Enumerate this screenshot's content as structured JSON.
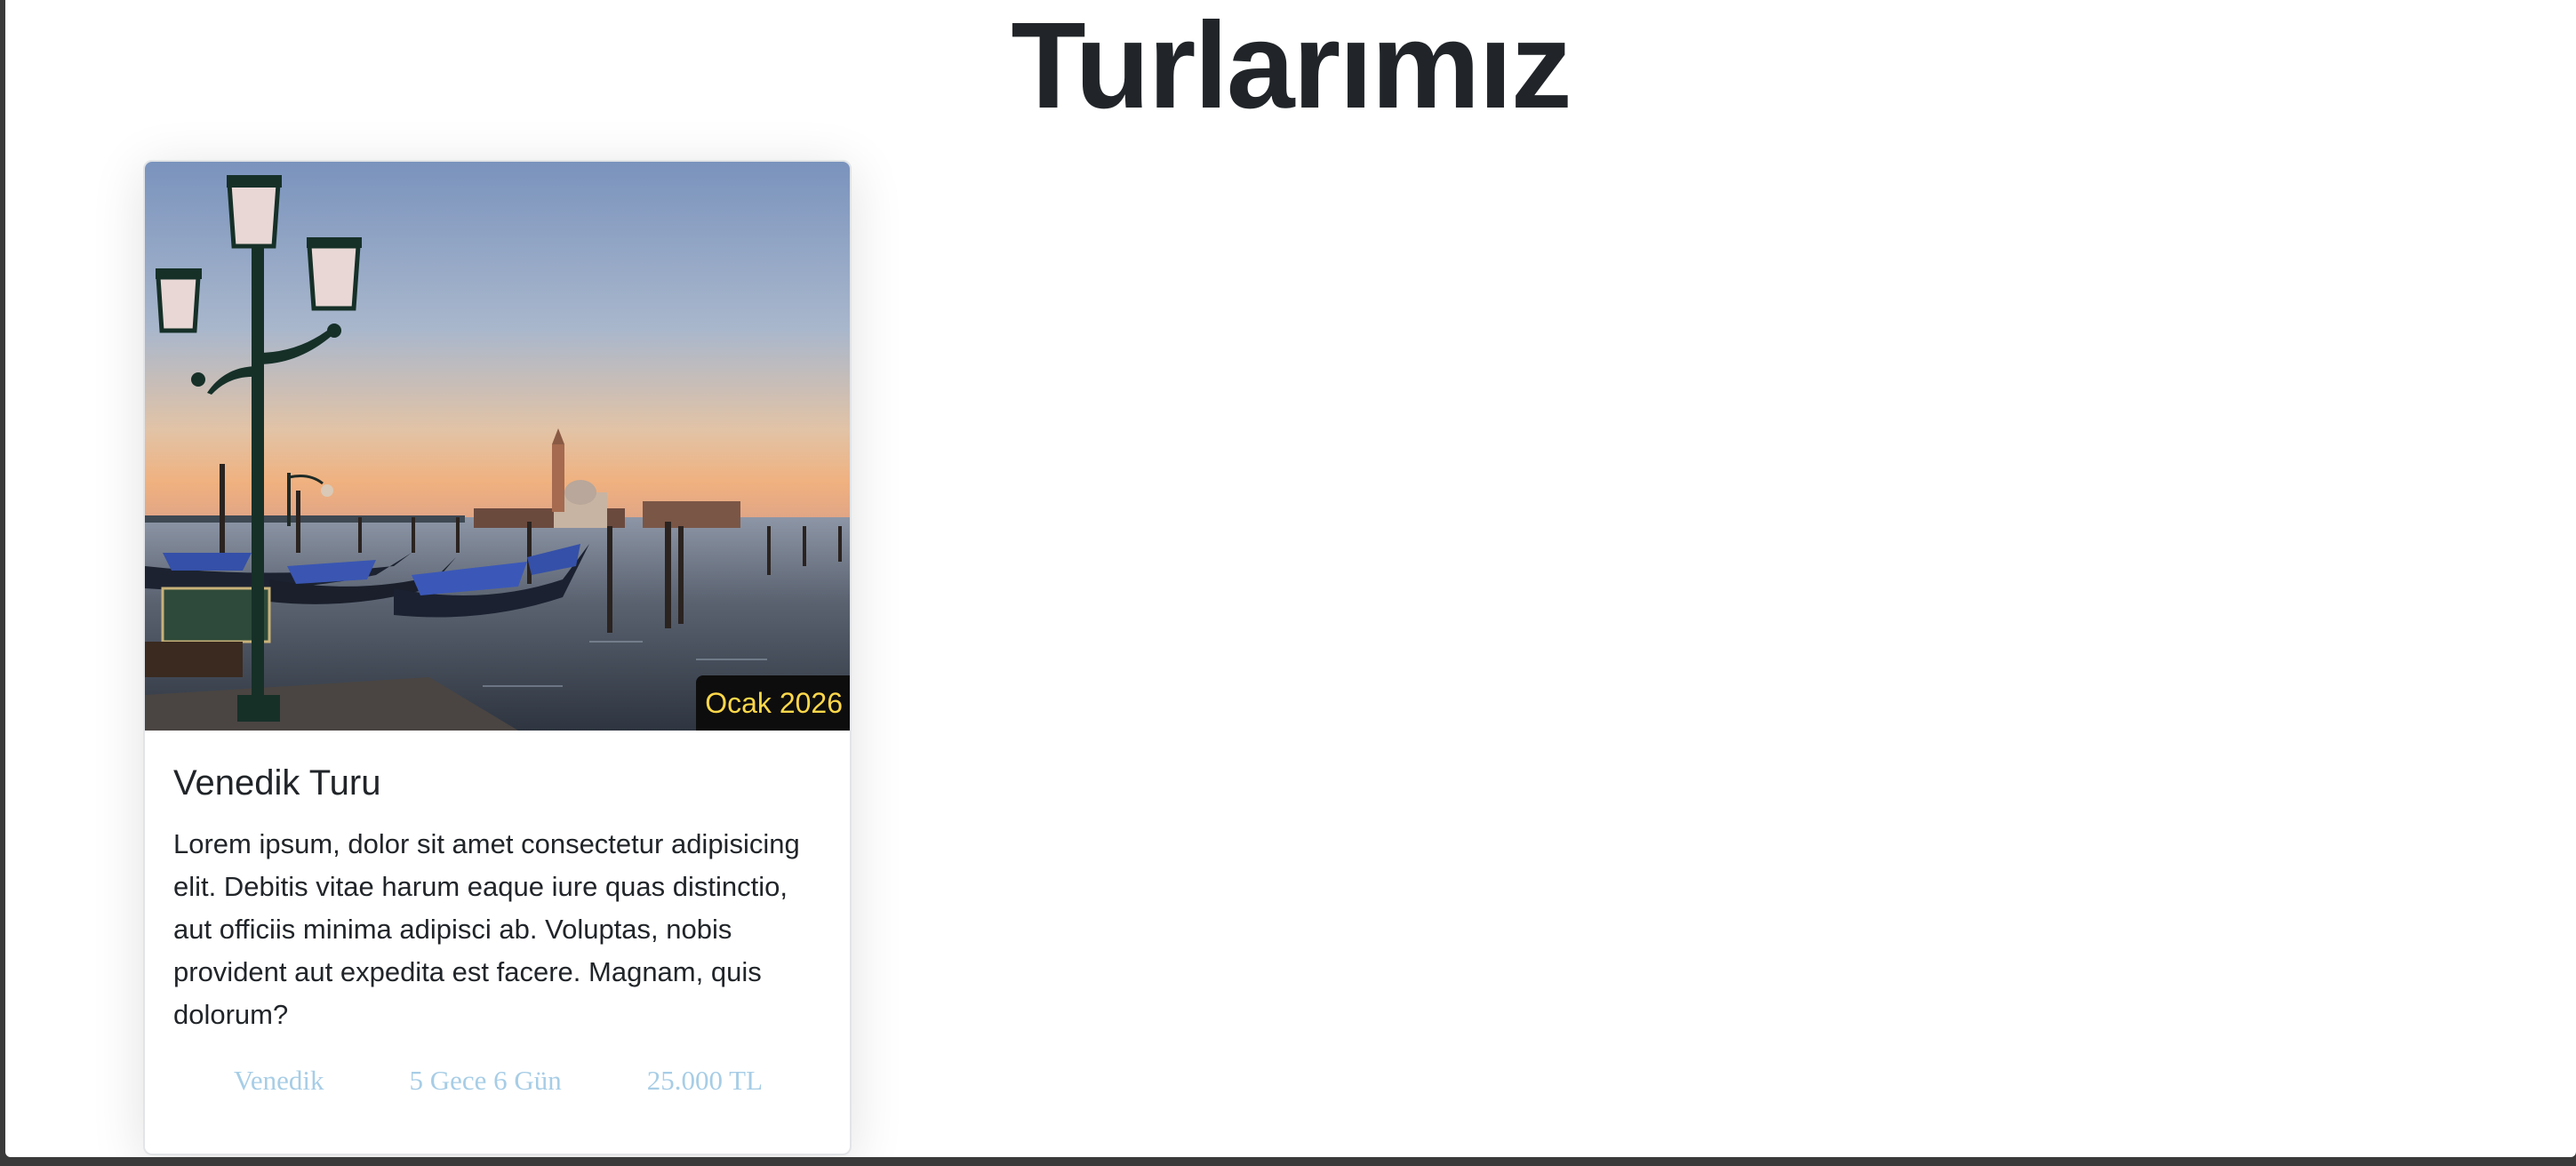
{
  "page": {
    "title": "Turlarımız"
  },
  "tours": [
    {
      "title": "Venedik Turu",
      "date_badge": "Ocak 2026",
      "description": "Lorem ipsum, dolor sit amet consectetur adipisicing elit. Debitis vitae harum eaque iure quas distinctio, aut officiis minima adipisci ab. Voluptas, nobis provident aut expedita est facere. Magnam, quis dolorum?",
      "location": "Venedik",
      "duration": "5 Gece 6 Gün",
      "price": "25.000 TL",
      "image": "venice-gondolas-sunset"
    }
  ],
  "colors": {
    "title": "#212529",
    "badge_bg": "#0d0d0d",
    "badge_text": "#ffd84a",
    "meta_text": "#a7cde6"
  }
}
